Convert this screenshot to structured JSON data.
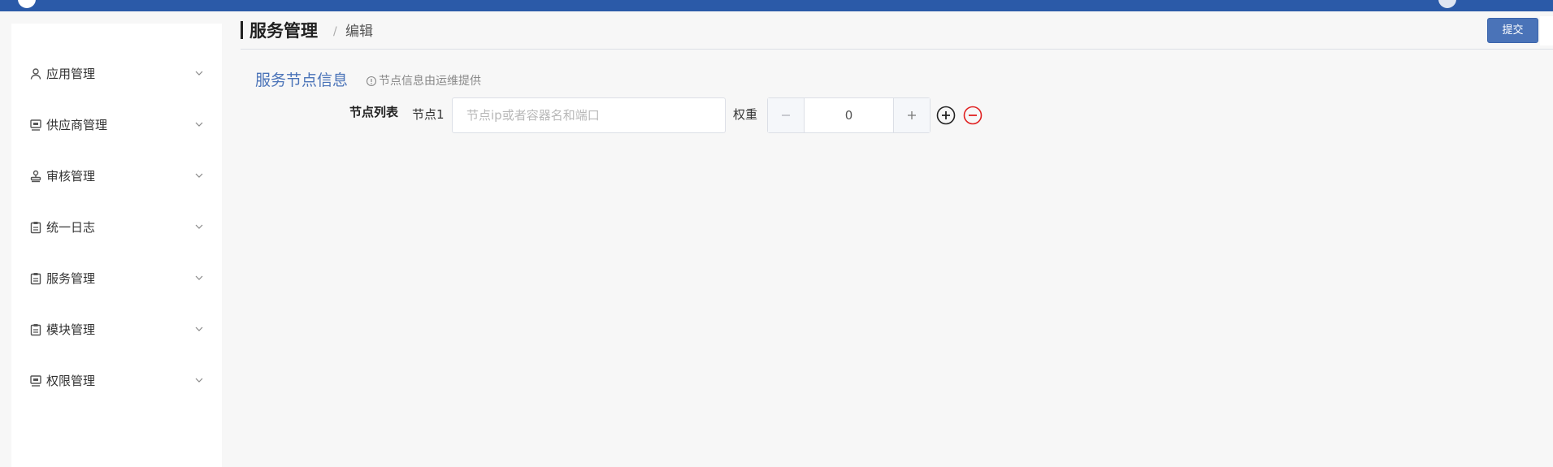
{
  "sidebar": {
    "items": [
      {
        "label": "应用管理",
        "icon": "user-icon"
      },
      {
        "label": "供应商管理",
        "icon": "monitor-icon"
      },
      {
        "label": "审核管理",
        "icon": "stamp-icon"
      },
      {
        "label": "统一日志",
        "icon": "clipboard-icon"
      },
      {
        "label": "服务管理",
        "icon": "clipboard-icon"
      },
      {
        "label": "模块管理",
        "icon": "clipboard-icon"
      },
      {
        "label": "权限管理",
        "icon": "monitor-icon"
      }
    ]
  },
  "header": {
    "title": "服务管理",
    "separator": "/",
    "breadcrumb_current": "编辑",
    "submit_label": "提交"
  },
  "section": {
    "title": "服务节点信息",
    "hint": "节点信息由运维提供"
  },
  "form": {
    "field_label": "节点列表",
    "node_label": "节点1",
    "node_input_value": "",
    "node_input_placeholder": "节点ip或者容器名和端口",
    "weight_label": "权重",
    "weight_value": "0",
    "decrement_symbol": "−",
    "increment_symbol": "+"
  },
  "colors": {
    "topbar": "#2b5aa8",
    "accent": "#4a73b8",
    "remove": "#e02020"
  }
}
